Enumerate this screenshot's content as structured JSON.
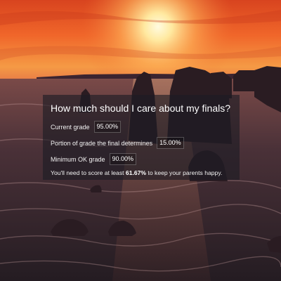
{
  "calculator": {
    "title": "How much should I care about my finals?",
    "fields": [
      {
        "label": "Current grade",
        "value": "95.00%"
      },
      {
        "label": "Portion of grade the final determines",
        "value": "15.00%"
      },
      {
        "label": "Minimum OK grade",
        "value": "90.00%"
      }
    ],
    "result": {
      "prefix": "You'll need to score at least",
      "score": "61.67%",
      "suffix": "to keep your parents happy."
    }
  },
  "background": {
    "icon": "sunset-sea-stacks-photo",
    "colors": {
      "sky_top": "#e8502a",
      "sky_glow": "#ffd36a",
      "sea": "#3a2a2e"
    }
  }
}
